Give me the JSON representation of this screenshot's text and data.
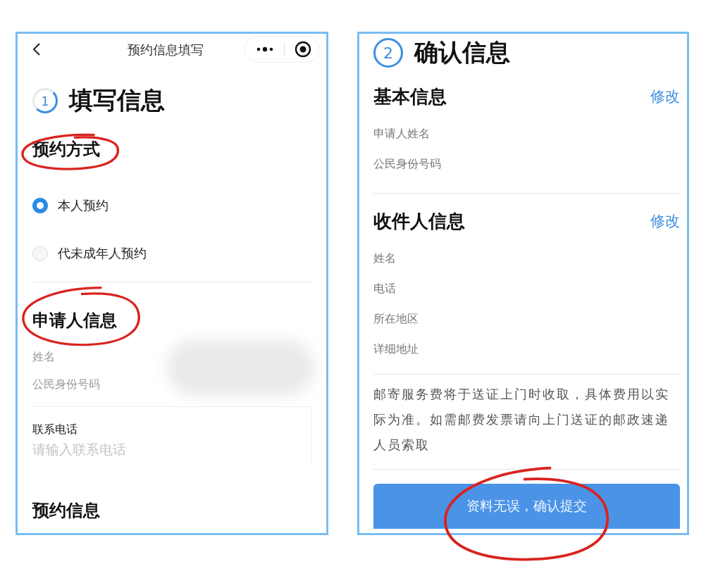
{
  "left_screen": {
    "nav_title": "预约信息填写",
    "step": {
      "number": "1",
      "title": "填写信息"
    },
    "method_section": {
      "title": "预约方式",
      "options": [
        {
          "label": "本人预约",
          "selected": true
        },
        {
          "label": "代未成年人预约",
          "selected": false
        }
      ]
    },
    "applicant_section": {
      "title": "申请人信息",
      "fields": [
        "姓名",
        "公民身份号码"
      ],
      "phone": {
        "label": "联系电话",
        "placeholder": "请输入联系电话"
      }
    },
    "next_section": {
      "title": "预约信息"
    }
  },
  "right_screen": {
    "step": {
      "number": "2",
      "title": "确认信息"
    },
    "sections": [
      {
        "title": "基本信息",
        "action": "修改",
        "fields": [
          "申请人姓名",
          "公民身份号码"
        ]
      },
      {
        "title": "收件人信息",
        "action": "修改",
        "fields": [
          "姓名",
          "电话",
          "所在地区",
          "详细地址"
        ]
      }
    ],
    "notice": "邮寄服务费将于送证上门时收取，具体费用以实际为准。如需邮费发票请向上门送证的邮政速递人员索取",
    "submit_button": "资料无误，确认提交"
  }
}
